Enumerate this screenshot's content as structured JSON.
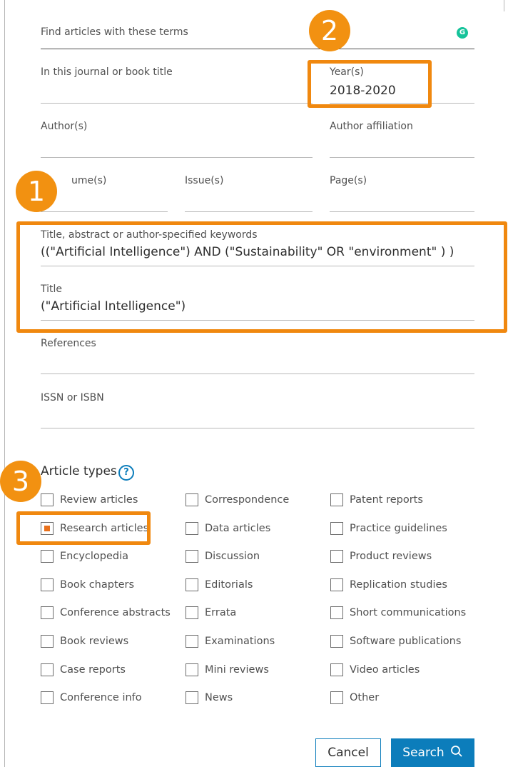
{
  "search_form": {
    "terms_label": "Find articles with these terms",
    "journal_label": "In this journal or book title",
    "journal_value": "",
    "year_label": "Year(s)",
    "year_value": "2018-2020",
    "author_label": "Author(s)",
    "author_value": "",
    "affiliation_label": "Author affiliation",
    "affiliation_value": "",
    "volume_label": "ume(s)",
    "issue_label": "Issue(s)",
    "pages_label": "Page(s)",
    "tak_label": "Title, abstract or author-specified keywords",
    "tak_value": "((\"Artificial Intelligence\") AND (\"Sustainability\" OR \"environment\" ) )",
    "title_label": "Title",
    "title_value": "(\"Artificial Intelligence\")",
    "references_label": "References",
    "issn_label": "ISSN or ISBN"
  },
  "annotations": {
    "badge1": "1",
    "badge2": "2",
    "badge3": "3",
    "highlight_color": "#f0880f"
  },
  "article_types": {
    "title": "Article types",
    "help_icon": "?",
    "columns": [
      [
        "Review articles",
        "Research articles",
        "Encyclopedia",
        "Book chapters",
        "Conference abstracts",
        "Book reviews",
        "Case reports",
        "Conference info"
      ],
      [
        "Correspondence",
        "Data articles",
        "Discussion",
        "Editorials",
        "Errata",
        "Examinations",
        "Mini reviews",
        "News"
      ],
      [
        "Patent reports",
        "Practice guidelines",
        "Product reviews",
        "Replication studies",
        "Short communications",
        "Software publications",
        "Video articles",
        "Other"
      ]
    ],
    "checked": [
      "Research articles"
    ]
  },
  "actions": {
    "cancel_label": "Cancel",
    "search_label": "Search",
    "accent_color": "#0c7dbb"
  },
  "icons": {
    "grammarly": "grammarly-icon",
    "help": "help-icon",
    "search": "search-icon"
  }
}
